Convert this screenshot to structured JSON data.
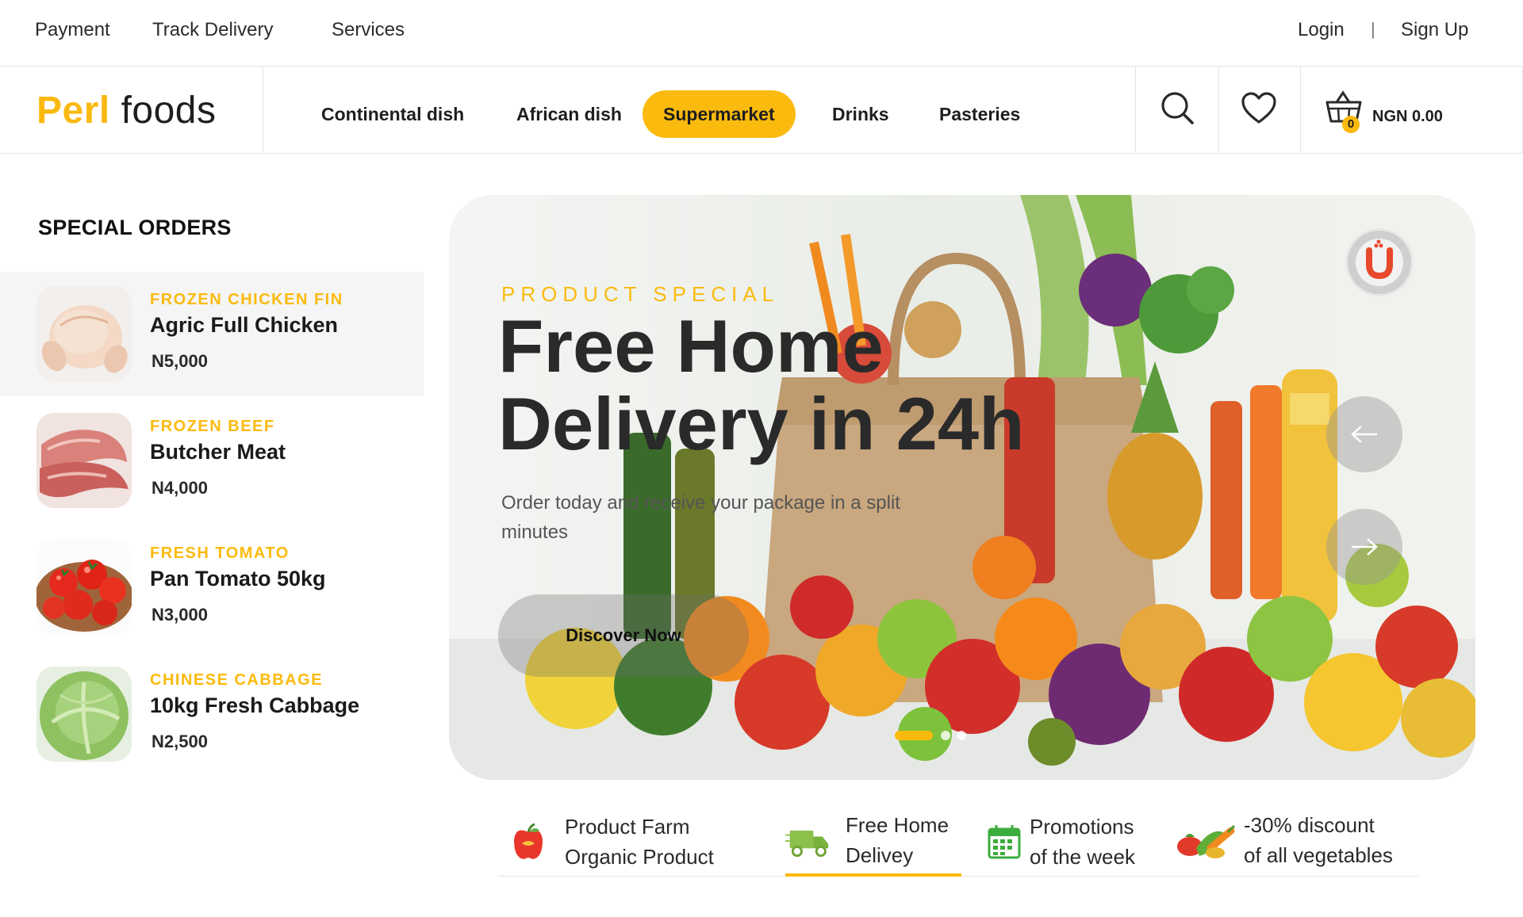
{
  "topbar": {
    "links": [
      "Payment",
      "Track Delivery",
      "Services"
    ],
    "login": "Login",
    "separator": "|",
    "signup": "Sign Up"
  },
  "header": {
    "logo_part1": "Perl",
    "logo_part2": "foods",
    "nav": [
      "Continental dish",
      "African dish",
      "Supermarket",
      "Drinks",
      "Pasteries"
    ],
    "active_nav": "Supermarket",
    "cart_count": "0",
    "cart_total": "NGN 0.00",
    "icons": [
      "search-icon",
      "heart-icon",
      "shopping-basket-icon"
    ]
  },
  "special_orders": {
    "title": "SPECIAL ORDERS",
    "items": [
      {
        "category": "FROZEN CHICKEN FIN",
        "name": "Agric Full Chicken",
        "price": "N5,000",
        "image": "raw-chicken"
      },
      {
        "category": "FROZEN BEEF",
        "name": "Butcher Meat",
        "price": "N4,000",
        "image": "raw-beef"
      },
      {
        "category": "FRESH TOMATO",
        "name": "Pan Tomato 50kg",
        "price": "N3,000",
        "image": "tomatoes-bowl"
      },
      {
        "category": "CHINESE CABBAGE",
        "name": "10kg Fresh Cabbage",
        "price": "N2,500",
        "image": "cabbage"
      }
    ]
  },
  "hero": {
    "subtitle": "PRODUCT SPECIAL",
    "title": "Free Home Delivery in 24h",
    "description": "Order today and receive your package in a split minutes",
    "button": "Discover Now",
    "slides": 3,
    "active_slide": 1,
    "icons": [
      "brand-u-icon",
      "arrow-left-icon",
      "arrow-right-icon"
    ]
  },
  "features": [
    {
      "line1": "Product Farm",
      "line2": "Organic Product",
      "icon": "apple-icon"
    },
    {
      "line1": "Free Home",
      "line2": "Delivey",
      "icon": "delivery-truck-icon"
    },
    {
      "line1": "Promotions",
      "line2": "of the week",
      "icon": "calendar-icon"
    },
    {
      "line1": "-30% discount",
      "line2": "of all vegetables",
      "icon": "vegetables-icon"
    }
  ],
  "colors": {
    "accent": "#fbba0e",
    "text": "#1e1e1e",
    "muted": "#555555",
    "green": "#7cb342"
  }
}
